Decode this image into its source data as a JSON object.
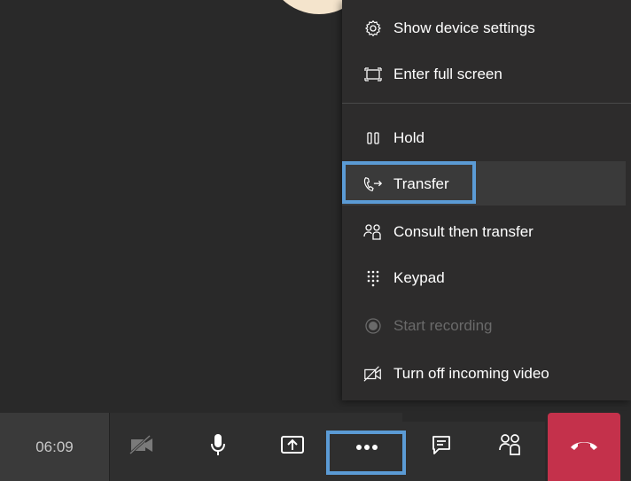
{
  "menu": {
    "items": [
      {
        "label": "Show device settings",
        "icon": "gear-icon"
      },
      {
        "label": "Enter full screen",
        "icon": "fullscreen-icon"
      },
      {
        "label": "Hold",
        "icon": "hold-icon"
      },
      {
        "label": "Transfer",
        "icon": "transfer-phone-icon",
        "highlighted": true
      },
      {
        "label": "Consult then transfer",
        "icon": "people-icon"
      },
      {
        "label": "Keypad",
        "icon": "keypad-icon"
      },
      {
        "label": "Start recording",
        "icon": "record-icon",
        "disabled": true
      },
      {
        "label": "Turn off incoming video",
        "icon": "video-off-icon"
      }
    ]
  },
  "callbar": {
    "timer": "06:09",
    "buttons": [
      {
        "name": "camera",
        "icon": "video-off-icon",
        "disabled": true
      },
      {
        "name": "microphone",
        "icon": "microphone-icon"
      },
      {
        "name": "share",
        "icon": "share-screen-icon"
      },
      {
        "name": "more-actions",
        "icon": "more-icon",
        "focused": true
      },
      {
        "name": "chat",
        "icon": "chat-icon"
      },
      {
        "name": "participants",
        "icon": "people-icon"
      },
      {
        "name": "hang-up",
        "icon": "hang-up-icon"
      }
    ]
  },
  "colors": {
    "background": "#292929",
    "menu_bg": "#2d2c2c",
    "focus_outline": "#5b9bd5",
    "hangup": "#c4314b",
    "disabled_text": "#6a6a6a"
  }
}
